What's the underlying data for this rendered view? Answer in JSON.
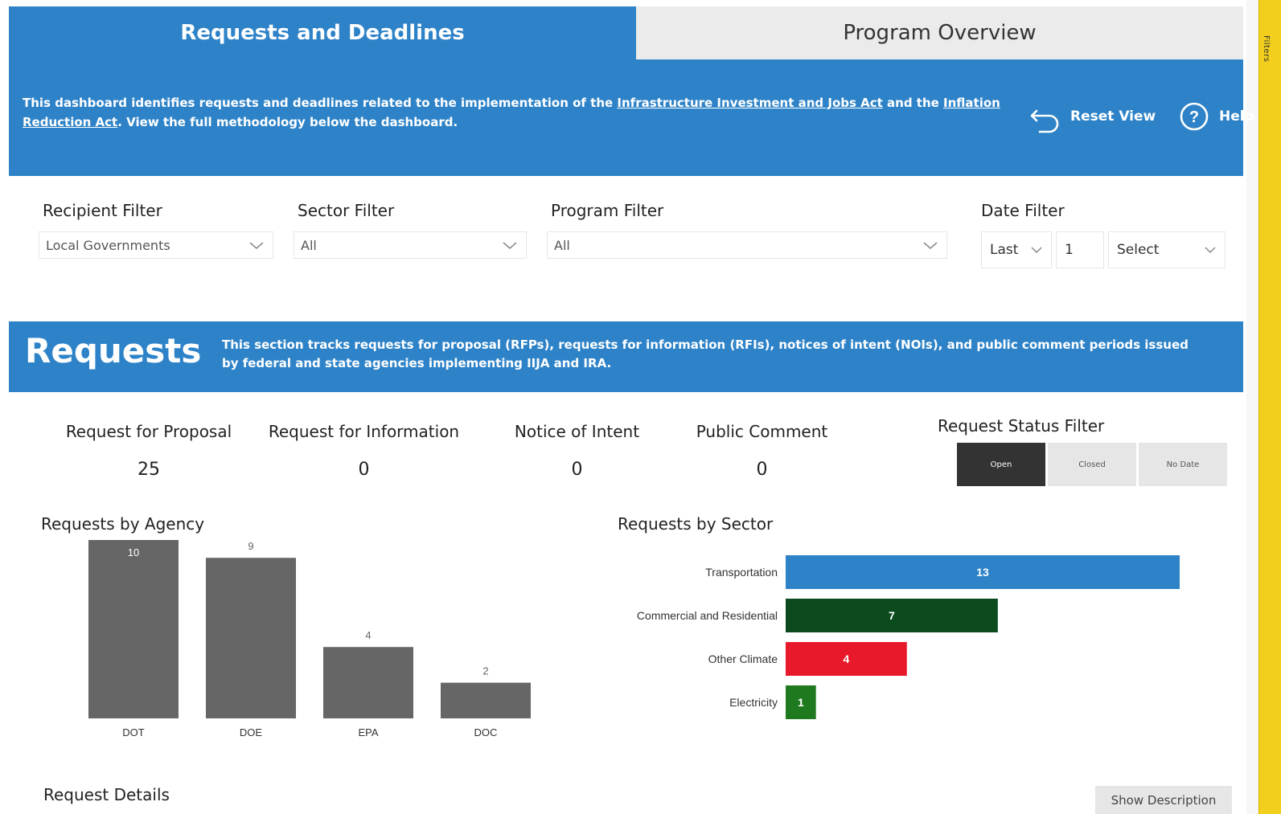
{
  "tabs": [
    {
      "label": "Requests and Deadlines",
      "active": true
    },
    {
      "label": "Program Overview",
      "active": false
    }
  ],
  "header": {
    "text_pre": "This dashboard identifies requests and deadlines related to the implementation of the ",
    "link_iija": "Infrastructure Investment and Jobs Act",
    "text_mid": " and the ",
    "link_ira": "Inflation Reduction Act",
    "text_post": ". View the full methodology below the dashboard.",
    "reset_label": "Reset View",
    "help_label": "Help",
    "color": "#2e83c8"
  },
  "filters": {
    "recipient": {
      "label": "Recipient Filter",
      "value": "Local Governments"
    },
    "sector": {
      "label": "Sector Filter",
      "value": "All"
    },
    "program": {
      "label": "Program Filter",
      "value": "All"
    },
    "date": {
      "label": "Date Filter",
      "relative": "Last",
      "count": "1",
      "unit": "Select"
    }
  },
  "requests_section": {
    "title": "Requests",
    "description": "This section tracks requests for proposal (RFPs), requests for information (RFIs), notices of intent (NOIs), and public comment periods issued by federal and state agencies implementing IIJA and IRA."
  },
  "kpis": [
    {
      "label": "Request for Proposal",
      "value": "25"
    },
    {
      "label": "Request for Information",
      "value": "0"
    },
    {
      "label": "Notice of Intent",
      "value": "0"
    },
    {
      "label": "Public Comment",
      "value": "0"
    }
  ],
  "status_filter": {
    "title": "Request Status Filter",
    "options": [
      "Open",
      "Closed",
      "No Date"
    ],
    "selected": "Open"
  },
  "chart_data": [
    {
      "type": "bar",
      "title": "Requests by Agency",
      "categories": [
        "DOT",
        "DOE",
        "EPA",
        "DOC"
      ],
      "values": [
        10,
        9,
        4,
        2
      ],
      "color": "#666666",
      "ylim": [
        0,
        10
      ]
    },
    {
      "type": "bar",
      "orientation": "horizontal",
      "title": "Requests by Sector",
      "categories": [
        "Transportation",
        "Commercial and Residential",
        "Other Climate",
        "Electricity"
      ],
      "values": [
        13,
        7,
        4,
        1
      ],
      "colors": [
        "#2e83c8",
        "#0b4a1c",
        "#e8192b",
        "#1f7a1f"
      ],
      "xlim": [
        0,
        13
      ]
    }
  ],
  "details": {
    "title": "Request Details",
    "show_description_label": "Show Description"
  },
  "side_pane": {
    "label": "Filters"
  }
}
